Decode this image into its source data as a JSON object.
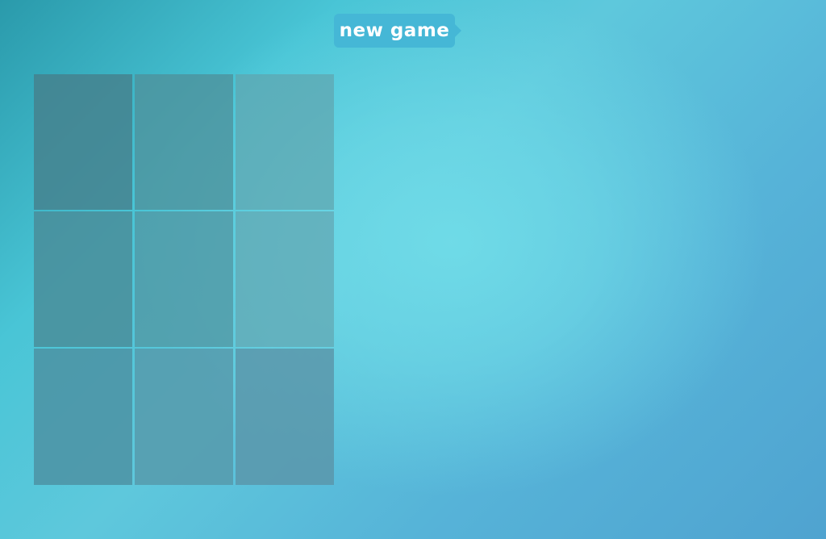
{
  "new_game_button": {
    "label": "new game"
  },
  "board": {
    "rows": 3,
    "columns": 3,
    "cells": [
      "",
      "",
      "",
      "",
      "",
      "",
      "",
      "",
      ""
    ]
  },
  "colors": {
    "background_dark": "#2a9aab",
    "background_light": "#70dce8",
    "background_edge": "#4fa3d0",
    "button": "#45b7d6",
    "button_text": "#ffffff",
    "cell": "#4f96a4"
  }
}
